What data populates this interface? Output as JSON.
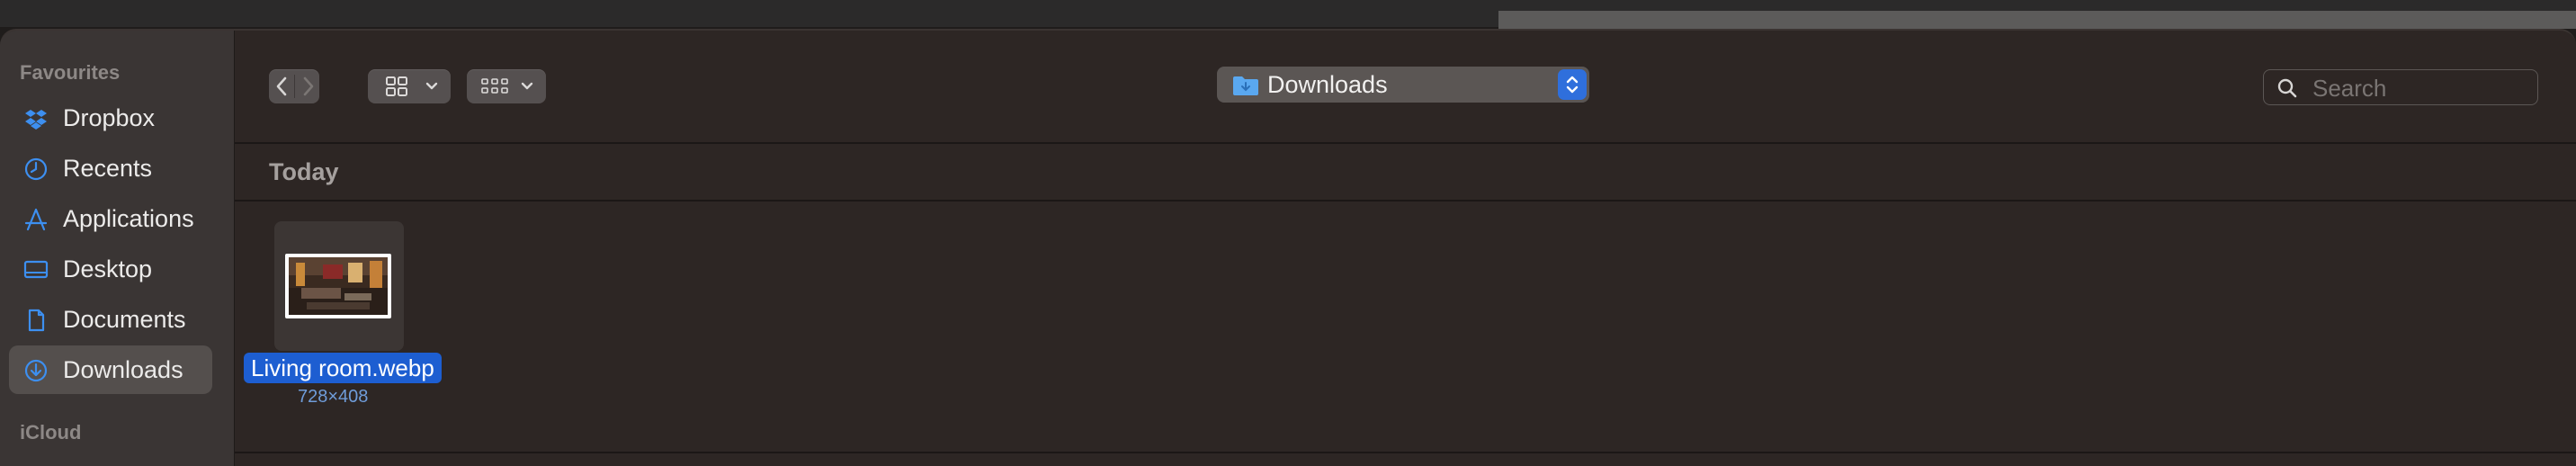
{
  "sidebar": {
    "favourites_heading": "Favourites",
    "items": [
      {
        "label": "Dropbox",
        "icon": "dropbox-icon"
      },
      {
        "label": "Recents",
        "icon": "clock-icon"
      },
      {
        "label": "Applications",
        "icon": "applications-icon"
      },
      {
        "label": "Desktop",
        "icon": "desktop-icon"
      },
      {
        "label": "Documents",
        "icon": "document-icon"
      },
      {
        "label": "Downloads",
        "icon": "download-icon",
        "selected": true
      }
    ],
    "icloud_heading": "iCloud"
  },
  "toolbar": {
    "location": "Downloads",
    "search_placeholder": "Search"
  },
  "content": {
    "section": "Today",
    "files": [
      {
        "name": "Living room.webp",
        "dimensions": "728×408"
      }
    ]
  },
  "colors": {
    "accent": "#1d5ed1",
    "icon_blue": "#3d8ff0",
    "sidebar_bg": "#3a3534",
    "window_bg": "#2d2624"
  }
}
